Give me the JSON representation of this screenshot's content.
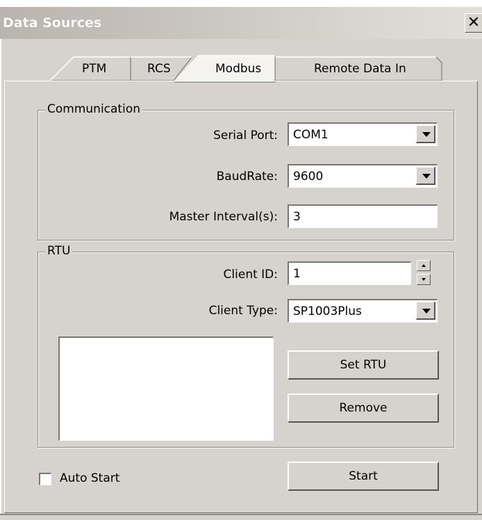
{
  "window": {
    "title": "Data Sources",
    "close_label": "✕"
  },
  "tabs": [
    {
      "label": "PTM",
      "active": false
    },
    {
      "label": "RCS",
      "active": false
    },
    {
      "label": "Modbus",
      "active": true
    },
    {
      "label": "Remote Data In",
      "active": false
    }
  ],
  "communication": {
    "group_label": "Communication",
    "serial_port_label": "Serial Port:",
    "serial_port_value": "COM1",
    "baud_label": "BaudRate:",
    "baud_value": "9600",
    "interval_label": "Master Interval(s):",
    "interval_value": "3"
  },
  "rtu": {
    "group_label": "RTU",
    "client_id_label": "Client ID:",
    "client_id_value": "1",
    "client_type_label": "Client Type:",
    "client_type_value": "SP1003Plus",
    "set_rtu_label": "Set RTU",
    "remove_label": "Remove"
  },
  "footer": {
    "auto_start_label": "Auto Start",
    "start_label": "Start"
  }
}
